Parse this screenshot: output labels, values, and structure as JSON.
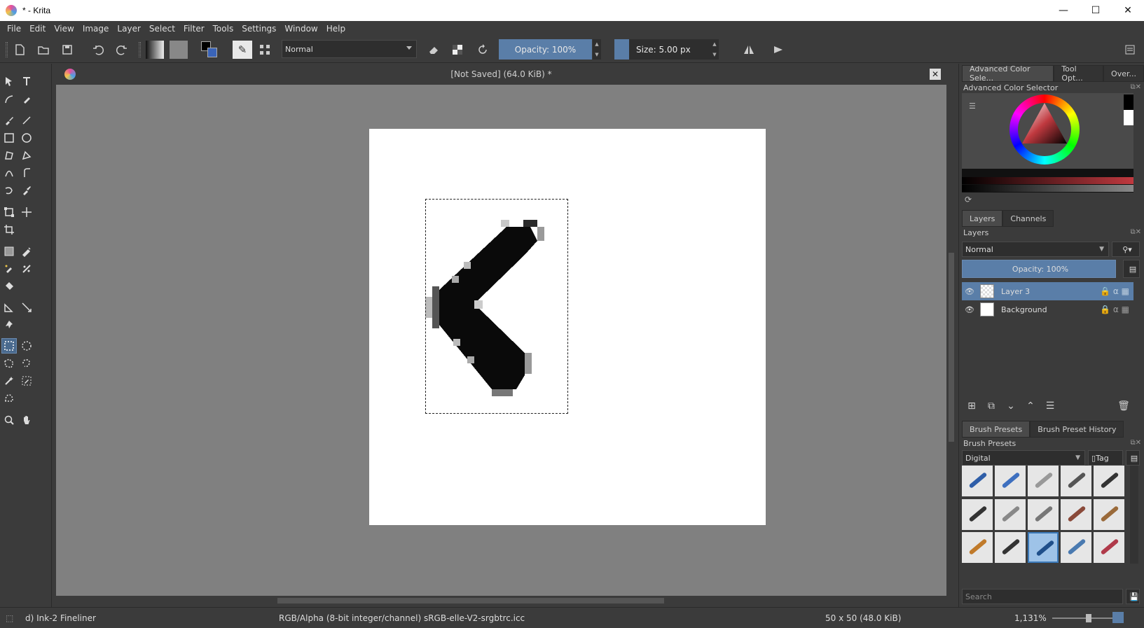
{
  "window": {
    "title": "* - Krita",
    "minimize": "—",
    "maximize": "☐",
    "close": "✕"
  },
  "menu": [
    "File",
    "Edit",
    "View",
    "Image",
    "Layer",
    "Select",
    "Filter",
    "Tools",
    "Settings",
    "Window",
    "Help"
  ],
  "toolbar": {
    "blend_mode": "Normal",
    "opacity_label": "Opacity:  100%",
    "size_label": "Size:  5.00 px"
  },
  "document": {
    "tab_title": "[Not Saved]  (64.0 KiB) *"
  },
  "dock": {
    "top_tabs": [
      "Advanced Color Sele...",
      "Tool Opt...",
      "Over..."
    ],
    "color_selector_title": "Advanced Color Selector",
    "layer_tabs": [
      "Layers",
      "Channels"
    ],
    "layers_title": "Layers",
    "layer_blend": "Normal",
    "layer_opacity": "Opacity:  100%",
    "layers": [
      {
        "name": "Layer 3",
        "selected": true
      },
      {
        "name": "Background",
        "selected": false
      }
    ],
    "brush_tabs": [
      "Brush Presets",
      "Brush Preset History"
    ],
    "brush_presets_title": "Brush Presets",
    "brush_filter": "Digital",
    "tag_label": "Tag",
    "search_placeholder": "Search"
  },
  "status": {
    "brush": "d) Ink-2 Fineliner",
    "color_space": "RGB/Alpha (8-bit integer/channel)  sRGB-elle-V2-srgbtrc.icc",
    "image_size": "50 x 50 (48.0 KiB)",
    "zoom": "1,131%"
  },
  "colors": {
    "accent": "#5a7ea8",
    "background": "#3b3b3b",
    "canvas_bg": "#808080"
  }
}
